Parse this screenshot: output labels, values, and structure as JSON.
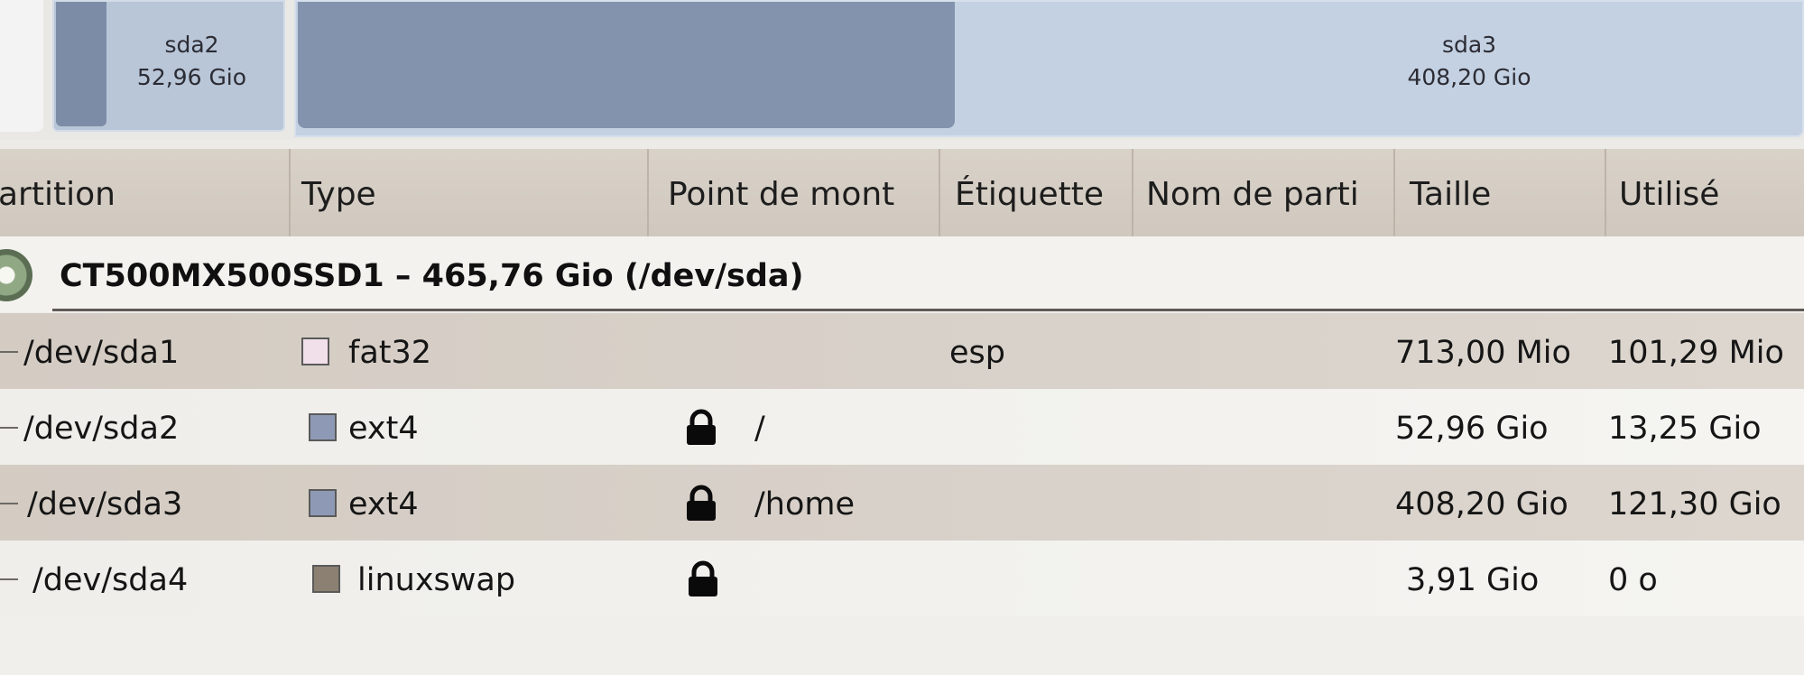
{
  "partition_map": {
    "blocks": [
      {
        "id": "sda2",
        "name": "sda2",
        "size": "52,96 Gio"
      },
      {
        "id": "sda3",
        "name": "sda3",
        "size": "408,20 Gio"
      }
    ]
  },
  "columns": {
    "partition": "artition",
    "type": "Type",
    "mount_point": "Point de mont",
    "label": "Étiquette",
    "partition_name": "Nom de parti",
    "size": "Taille",
    "used": "Utilisé"
  },
  "device": {
    "title": "CT500MX500SSD1 – 465,76 Gio (/dev/sda)",
    "icon": "disk-icon"
  },
  "partitions": [
    {
      "path": "/dev/sda1",
      "fs": "fat32",
      "fs_color": "#f1dfe9",
      "mount": "",
      "locked": false,
      "label": "esp",
      "size": "713,00 Mio",
      "used": "101,29 Mio"
    },
    {
      "path": "/dev/sda2",
      "fs": "ext4",
      "fs_color": "#8e9ab5",
      "mount": "/",
      "locked": true,
      "label": "",
      "size": "52,96 Gio",
      "used": "13,25 Gio"
    },
    {
      "path": "/dev/sda3",
      "fs": "ext4",
      "fs_color": "#8e9ab5",
      "mount": "/home",
      "locked": true,
      "label": "",
      "size": "408,20 Gio",
      "used": "121,30 Gio"
    },
    {
      "path": "/dev/sda4",
      "fs": "linuxswap",
      "fs_color": "#8c8072",
      "mount": "",
      "locked": true,
      "label": "",
      "size": "3,91 Gio",
      "used": "0 o"
    }
  ]
}
